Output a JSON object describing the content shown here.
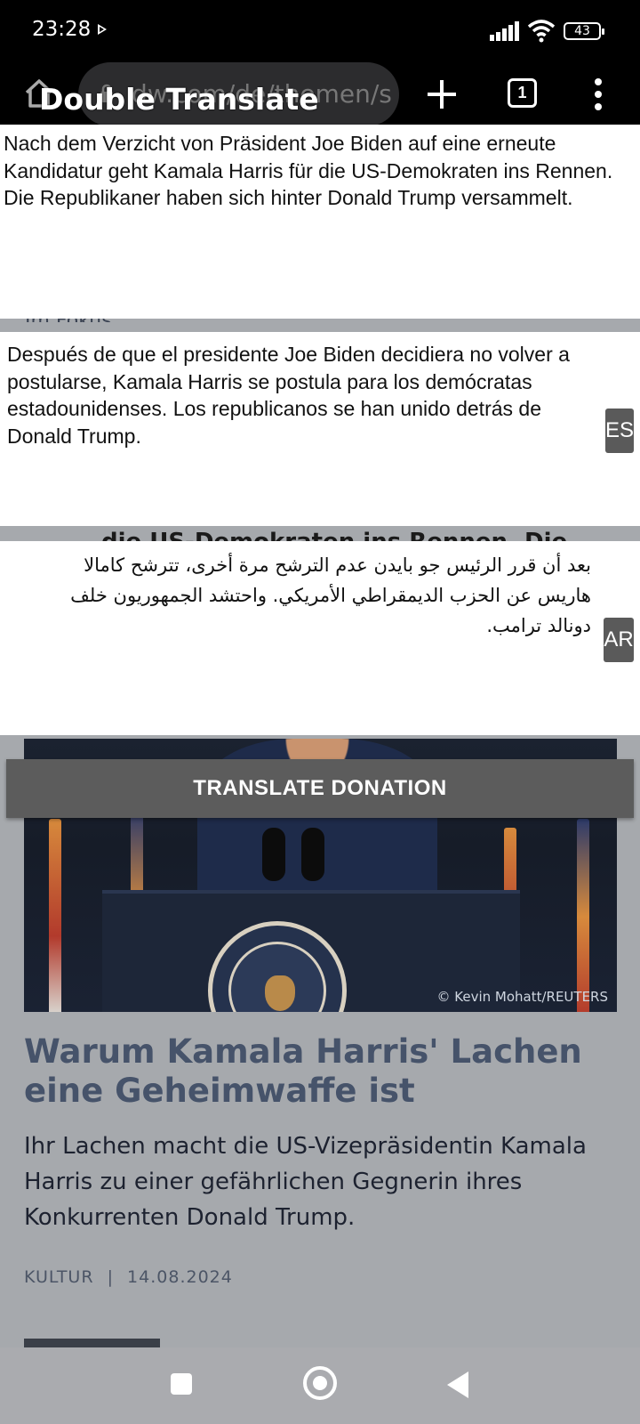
{
  "status_bar": {
    "time": "23:28",
    "battery": "43"
  },
  "browser": {
    "url": "dw.com/de/themen/s",
    "tab_count": "1"
  },
  "overlay": {
    "app_title": "Double Translate"
  },
  "background_page": {
    "fragment_1": "Im Fokus",
    "fragment_2": "die US-Demokraten ins Rennen. Die",
    "photo_credit": "© Kevin Mohatt/REUTERS",
    "article_headline": "Warum Kamala Harris' Lachen eine Geheimwaffe ist",
    "article_teaser": "Ihr Lachen macht die US-Vizepräsidentin Kamala Harris zu einer gefährlichen Gegnerin ihres Konkurrenten Donald Trump.",
    "article_category": "KULTUR",
    "article_separator": "|",
    "article_date": "14.08.2024"
  },
  "panels": {
    "source": {
      "text": "Nach dem Verzicht von Präsident Joe Biden auf eine erneute Kandidatur geht Kamala Harris für die US-Demokraten ins Rennen. Die Republikaner haben sich hinter Donald Trump versammelt."
    },
    "spanish": {
      "text": "Después de que el presidente Joe Biden decidiera no volver a postularse, Kamala Harris se postula para los demócratas estadounidenses. Los republicanos se han unido detrás de Donald Trump.",
      "lang_code": "ES"
    },
    "arabic": {
      "text": "بعد أن قرر الرئيس جو بايدن عدم الترشح مرة أخرى، تترشح كامالا هاريس عن الحزب الديمقراطي الأمريكي. واحتشد الجمهوريون خلف دونالد ترامب.",
      "lang_code": "AR"
    }
  },
  "donate_button": {
    "label": "TRANSLATE DONATION"
  },
  "colors": {
    "panel_bg": "#ffffff",
    "button_bg": "#5c5c5c",
    "headline": "#46536a",
    "page_dim": "#a6a9ad"
  },
  "icons": {
    "status": [
      "play-icon",
      "signal-icon",
      "wifi-icon",
      "battery-icon"
    ],
    "browser": [
      "home-icon",
      "lock-icon",
      "new-tab-icon",
      "tabs-icon",
      "more-menu-icon"
    ],
    "navigation": [
      "recent-apps-icon",
      "home-circle-icon",
      "back-icon"
    ]
  }
}
